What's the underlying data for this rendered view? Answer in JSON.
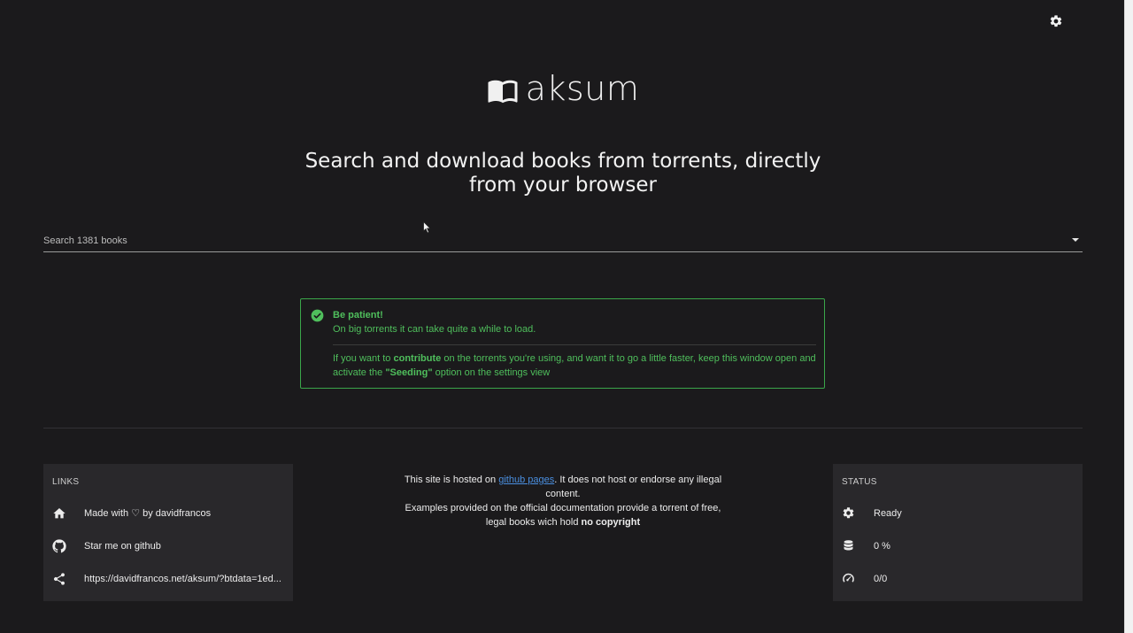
{
  "app": {
    "name": "aksum",
    "headline": "Search and download books from torrents, directly from your browser"
  },
  "search": {
    "placeholder": "Search 1381 books",
    "value": ""
  },
  "notice": {
    "title": "Be patient!",
    "line1": "On big torrents it can take quite a while to load.",
    "para_a": "If you want to ",
    "para_b": "contribute",
    "para_c": " on the torrents you're using, and want it to go a little faster, keep this window open and activate the ",
    "para_d": "\"Seeding\"",
    "para_e": " option on the settings view"
  },
  "links_panel": {
    "title": "LINKS",
    "items": [
      {
        "label": "Made with ♡ by davidfrancos",
        "icon": "home-icon"
      },
      {
        "label": "Star me on github",
        "icon": "github-icon"
      },
      {
        "label": "https://davidfrancos.net/aksum/?btdata=1ed...",
        "icon": "share-icon"
      }
    ]
  },
  "center_info": {
    "p1_a": "This site is hosted on ",
    "p1_link": "github pages",
    "p1_b": ". It does not host or endorse any illegal content.",
    "p2_a": "Examples provided on the official documentation provide a torrent of free, legal books wich hold ",
    "p2_b": "no copyright"
  },
  "status_panel": {
    "title": "STATUS",
    "items": [
      {
        "label": "Ready",
        "icon": "gear-icon"
      },
      {
        "label": "0 %",
        "icon": "database-icon"
      },
      {
        "label": "0/0",
        "icon": "speedometer-icon"
      }
    ]
  },
  "colors": {
    "background": "#1b1a1c",
    "panel": "#29282b",
    "success": "#4fbf5c",
    "link": "#4a8fe0"
  }
}
